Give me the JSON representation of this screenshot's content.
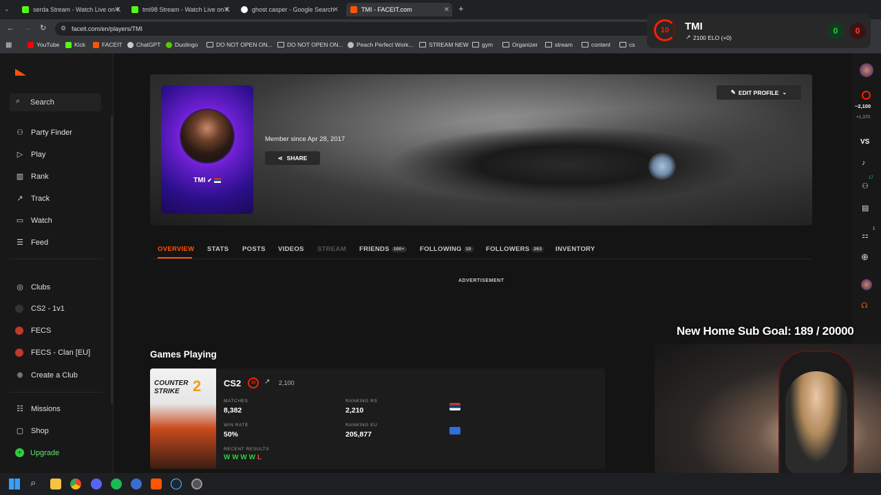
{
  "tabs": [
    {
      "label": "serda Stream - Watch Live on K",
      "color": "#53fc18"
    },
    {
      "label": "tmi98 Stream - Watch Live on K",
      "color": "#53fc18"
    },
    {
      "label": "ghost casper - Google Search",
      "color": "#4285f4"
    },
    {
      "label": "TMI - FACEIT.com",
      "color": "#ff5500"
    }
  ],
  "address": {
    "url": "faceit.com/en/players/TMI"
  },
  "bookmarks": [
    "YouTube",
    "Kick",
    "FACEIT",
    "ChatGPT",
    "Duolingo",
    "DO NOT OPEN ON...",
    "DO NOT OPEN ON...",
    "Peach Perfect Work...",
    "STREAM NEW",
    "gym",
    "Organizer",
    "stream",
    "content",
    "cs"
  ],
  "overlay": {
    "name": "TMI",
    "level": "10",
    "elo": "2100 ELO (+0)",
    "wins": "0",
    "losses": "0"
  },
  "sidebar": {
    "search": "Search",
    "items": [
      "Party Finder",
      "Play",
      "Rank",
      "Track",
      "Watch",
      "Feed"
    ],
    "clubs_header": "Clubs",
    "clubs": [
      "CS2 - 1v1",
      "FECS",
      "FECS - Clan [EU]"
    ],
    "create_club": "Create a Club",
    "bottom": [
      "Missions",
      "Shop"
    ],
    "upgrade": "Upgrade"
  },
  "profile": {
    "name": "TMI",
    "member_since": "Member since Apr 28, 2017",
    "share": "SHARE",
    "edit": "EDIT PROFILE"
  },
  "profile_tabs": [
    {
      "label": "OVERVIEW",
      "badge": ""
    },
    {
      "label": "STATS",
      "badge": ""
    },
    {
      "label": "POSTS",
      "badge": ""
    },
    {
      "label": "VIDEOS",
      "badge": ""
    },
    {
      "label": "STREAM",
      "badge": ""
    },
    {
      "label": "FRIENDS",
      "badge": "100+"
    },
    {
      "label": "FOLLOWING",
      "badge": "10"
    },
    {
      "label": "FOLLOWERS",
      "badge": "263"
    },
    {
      "label": "INVENTORY",
      "badge": ""
    }
  ],
  "advertisement": "ADVERTISEMENT",
  "games_heading": "Games Playing",
  "game": {
    "title": "CS2",
    "level": "10",
    "elo": "2,100",
    "logo_line1": "COUNTER",
    "logo_line2": "STRIKE",
    "logo_num": "2",
    "matches_label": "MATCHES",
    "matches": "8,382",
    "winrate_label": "WIN RATE",
    "winrate": "50%",
    "rank_rs_label": "RANKING RS",
    "rank_rs": "2,210",
    "rank_eu_label": "RANKING EU",
    "rank_eu": "205,877",
    "recent_label": "RECENT RESULTS",
    "recent": "W W W W",
    "recent_loss": "L"
  },
  "rail": {
    "elo": "~2,100",
    "delta": "+1,370",
    "vs": "VS",
    "badge1": "17",
    "badge2": "1"
  },
  "stream_overlay": {
    "sub_goal": "New Home Sub Goal:  189 / 20000"
  },
  "colors": {
    "accent": "#ff5500",
    "win": "#2ecc40",
    "loss": "#ff3b3b",
    "level": "#fe1f00"
  }
}
